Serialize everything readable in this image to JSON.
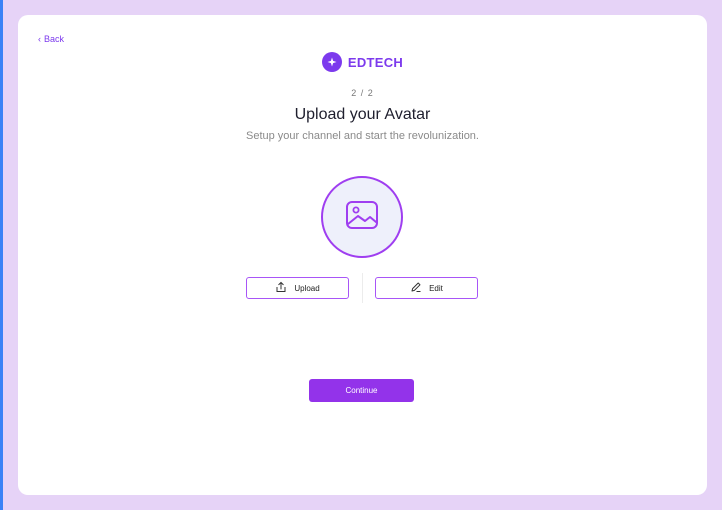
{
  "nav": {
    "back_label": "Back"
  },
  "brand": {
    "name": "EDTECH"
  },
  "header": {
    "step": "2 / 2",
    "title": "Upload your Avatar",
    "subtitle": "Setup your channel and start the revolunization."
  },
  "actions": {
    "upload_label": "Upload",
    "edit_label": "Edit",
    "continue_label": "Continue"
  },
  "colors": {
    "accent": "#7c3aed",
    "primary_button": "#9333ea",
    "page_background": "#e6d3f7",
    "avatar_background": "#eef0fb"
  },
  "icons": {
    "back": "chevron-left-icon",
    "brand": "sparkle-icon",
    "avatar": "image-icon",
    "upload": "upload-icon",
    "edit": "pencil-icon"
  }
}
